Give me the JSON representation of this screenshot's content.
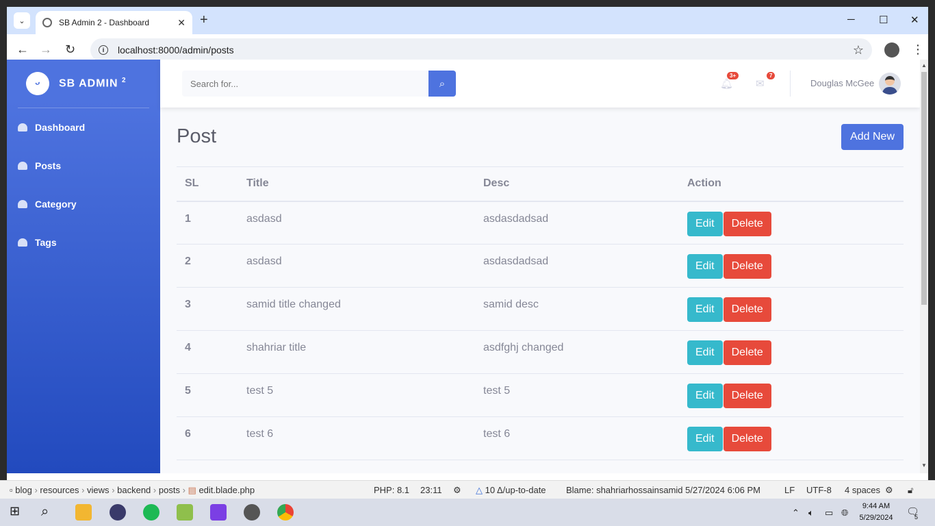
{
  "browser": {
    "tab_title": "SB Admin 2 - Dashboard",
    "url": "localhost:8000/admin/posts"
  },
  "app": {
    "brand": "SB ADMIN",
    "brand_sup": "2",
    "sidebar": [
      {
        "label": "Dashboard"
      },
      {
        "label": "Posts"
      },
      {
        "label": "Category"
      },
      {
        "label": "Tags"
      }
    ],
    "search_placeholder": "Search for...",
    "alerts_count": "3+",
    "messages_count": "7",
    "user_name": "Douglas McGee",
    "page_title": "Post",
    "add_button": "Add New",
    "table": {
      "headers": [
        "SL",
        "Title",
        "Desc",
        "Action"
      ],
      "edit_label": "Edit",
      "delete_label": "Delete",
      "rows": [
        {
          "sl": "1",
          "title": "asdasd",
          "desc": "asdasdadsad"
        },
        {
          "sl": "2",
          "title": "asdasd",
          "desc": "asdasdadsad"
        },
        {
          "sl": "3",
          "title": "samid title changed",
          "desc": "samid desc"
        },
        {
          "sl": "4",
          "title": "shahriar title",
          "desc": "asdfghj changed"
        },
        {
          "sl": "5",
          "title": "test 5",
          "desc": "test 5"
        },
        {
          "sl": "6",
          "title": "test 6",
          "desc": "test 6"
        }
      ]
    }
  },
  "ide_status": {
    "crumbs": [
      "blog",
      "resources",
      "views",
      "backend",
      "posts",
      "edit.blade.php"
    ],
    "php": "PHP: 8.1",
    "position": "23:11",
    "vcs": "10 Δ/up-to-date",
    "blame": "Blame: shahriarhossainsamid 5/27/2024 6:06 PM",
    "line_ending": "LF",
    "encoding": "UTF-8",
    "indent": "4 spaces"
  },
  "taskbar": {
    "time": "9:44 AM",
    "date": "5/29/2024",
    "notifications": "5"
  },
  "colors": {
    "primary": "#4e73df",
    "info": "#36b9cc",
    "danger": "#e74a3b"
  }
}
